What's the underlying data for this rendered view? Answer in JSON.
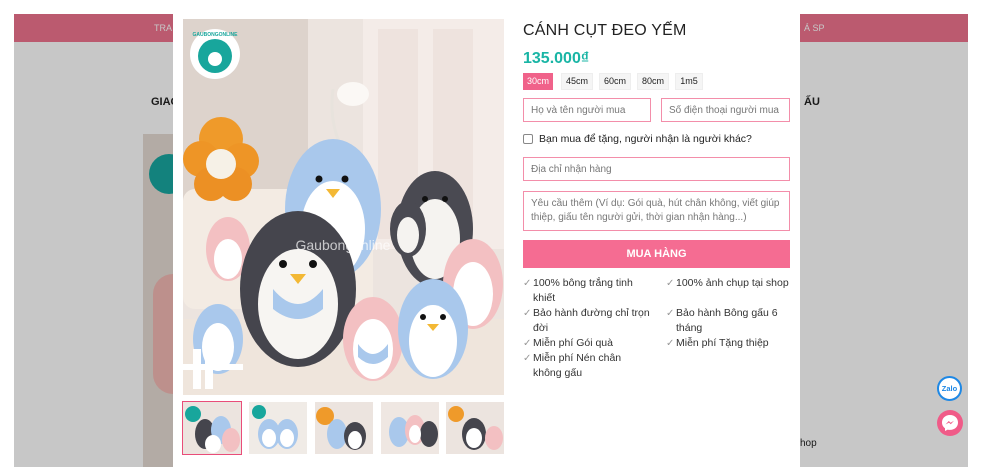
{
  "background_site": {
    "topbar_left": "TRA",
    "topbar_right": "Á SP",
    "nav_left": "GIAO",
    "nav_right": "ẤU",
    "shop_text": "hop"
  },
  "product": {
    "title": "CÁNH CỤT ĐEO YẾM",
    "price": "135.000₫",
    "watermark": "Gaubongonline",
    "logo_text": "GAUBONGONLINE",
    "sizes": [
      {
        "label": "30cm",
        "active": true
      },
      {
        "label": "45cm",
        "active": false
      },
      {
        "label": "60cm",
        "active": false
      },
      {
        "label": "80cm",
        "active": false
      },
      {
        "label": "1m5",
        "active": false
      }
    ]
  },
  "form": {
    "name_placeholder": "Họ và tên người mua",
    "phone_placeholder": "Số điện thoại người mua",
    "gift_checkbox_label": "Bạn mua để tặng, người nhận là người khác?",
    "address_placeholder": "Địa chỉ nhận hàng",
    "notes_placeholder": "Yêu cầu thêm (Ví dụ: Gói quà, hút chân không, viết giúp thiệp, giấu tên người gửi, thời gian nhận hàng...)",
    "buy_label": "MUA HÀNG"
  },
  "features": [
    "100% bông trắng tinh khiết",
    "100% ảnh chụp tại shop",
    "Bảo hành đường chỉ trọn đời",
    "Bảo hành Bông gấu 6 tháng",
    "Miễn phí Gói quà",
    "Miễn phí Tặng thiệp",
    "Miễn phí Nén chân không gấu"
  ],
  "floating": {
    "zalo_label": "Zalo"
  },
  "colors": {
    "accent_pink": "#f56c92",
    "price_teal": "#19b5a5",
    "penguin_blue": "#a9c8ec",
    "penguin_gray": "#4a4a52",
    "penguin_pink": "#f3c0c2"
  }
}
